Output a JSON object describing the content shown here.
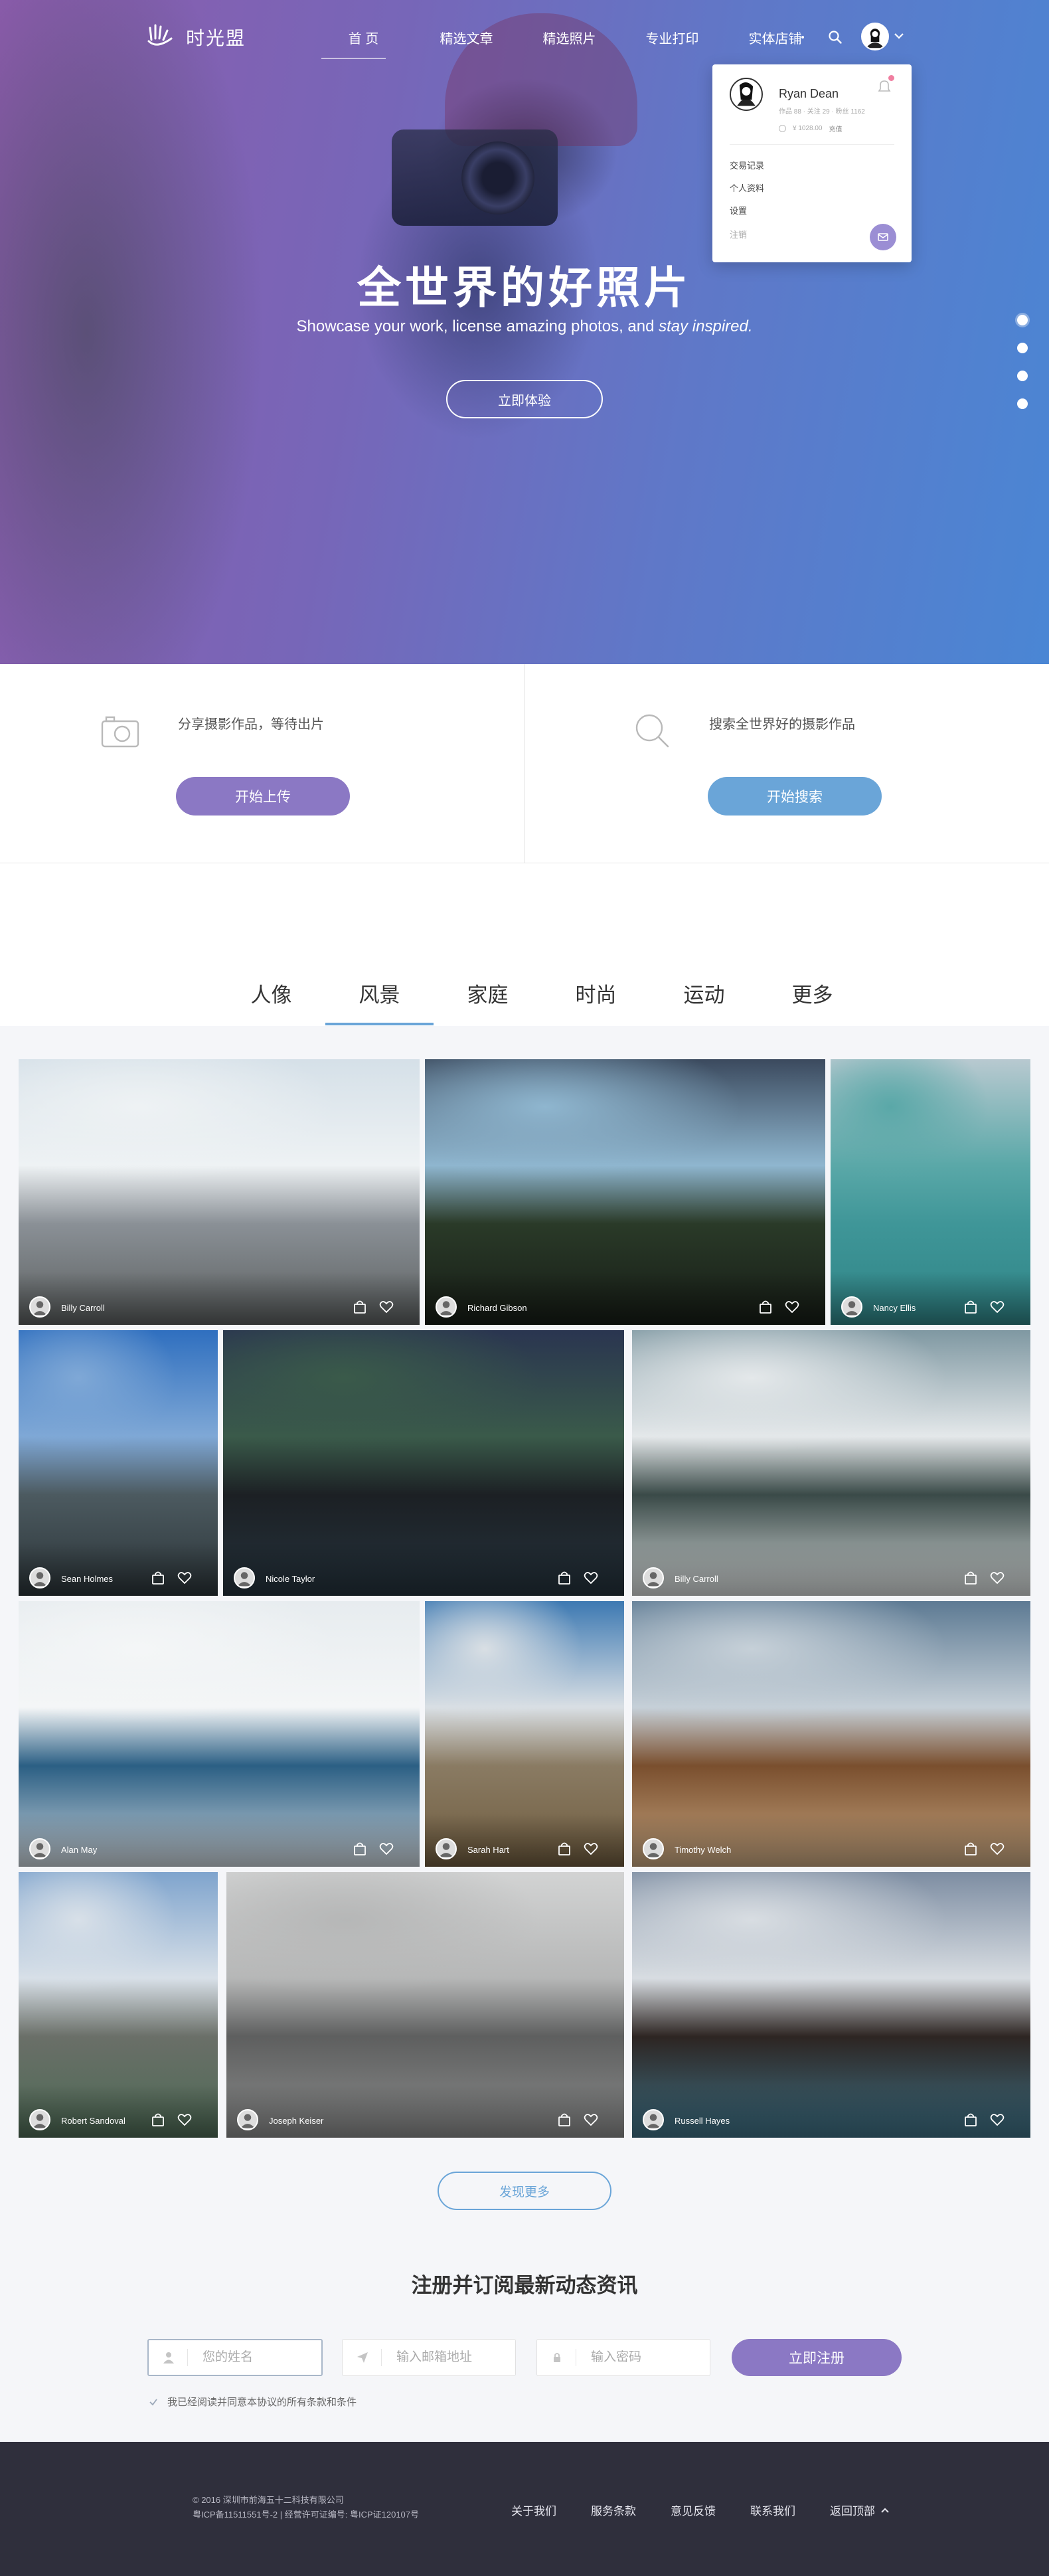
{
  "brand": {
    "name": "时光盟"
  },
  "nav": {
    "links": [
      "首 页",
      "精选文章",
      "精选照片",
      "专业打印",
      "实体店铺"
    ]
  },
  "user_menu": {
    "name": "Ryan Dean",
    "meta": "作品 88 · 关注 29 · 粉丝 1162",
    "balance": "¥ 1028.00",
    "recharge": "充值",
    "items": [
      "交易记录",
      "个人资料",
      "设置",
      "注销"
    ]
  },
  "hero": {
    "title": "全世界的好照片",
    "subtitle_main": "Showcase your work, license amazing photos, and ",
    "subtitle_em": "stay inspired.",
    "button": "立即体验",
    "slides": 4
  },
  "actions": {
    "upload_text": "分享摄影作品，等待出片",
    "upload_button": "开始上传",
    "search_text": "搜索全世界好的摄影作品",
    "search_button": "开始搜索"
  },
  "tabs": [
    "人像",
    "风景",
    "家庭",
    "时尚",
    "运动",
    "更多"
  ],
  "active_tab": "风景",
  "photos": [
    {
      "author": "Billy Carroll",
      "colors": [
        "#d5e0e8",
        "#eef2f4",
        "#8a9096",
        "#5b5f5f"
      ]
    },
    {
      "author": "Richard Gibson",
      "colors": [
        "#3b4a5e",
        "#8fb6cf",
        "#2a3a28",
        "#161c16"
      ]
    },
    {
      "author": "Nancy Ellis",
      "colors": [
        "#b8c9d0",
        "#5aa8a8",
        "#3f9698",
        "#2f8486"
      ]
    },
    {
      "author": "Sean Holmes",
      "colors": [
        "#2f6fbf",
        "#7fa8d6",
        "#4c5a60",
        "#2b3438"
      ]
    },
    {
      "author": "Nicole Taylor",
      "colors": [
        "#2a3550",
        "#3a5a4a",
        "#1c2024",
        "#24323c"
      ]
    },
    {
      "author": "Billy Carroll",
      "colors": [
        "#7f98a2",
        "#e4e8ea",
        "#3a4a48",
        "#d8dcdc"
      ]
    },
    {
      "author": "Alan May",
      "colors": [
        "#e7ecef",
        "#f4f6f7",
        "#2b5f84",
        "#ccd5dc"
      ]
    },
    {
      "author": "Sarah Hart",
      "colors": [
        "#3d79b2",
        "#d9dfe4",
        "#8a7b63",
        "#6f5c3f"
      ]
    },
    {
      "author": "Timothy Welch",
      "colors": [
        "#5d7a93",
        "#c6d0d8",
        "#7a4f2e",
        "#c7a680"
      ]
    },
    {
      "author": "Robert Sandoval",
      "colors": [
        "#7fa4cd",
        "#d8e0e8",
        "#6a6f68",
        "#4d6a55"
      ]
    },
    {
      "author": "Joseph Keiser",
      "colors": [
        "#d2d3d3",
        "#b6b7b7",
        "#5e5f5f",
        "#8b8c8c"
      ]
    },
    {
      "author": "Russell Hayes",
      "colors": [
        "#7d8da2",
        "#d8dde2",
        "#2d2522",
        "#3e7186"
      ]
    }
  ],
  "more_button": "发现更多",
  "subscribe": {
    "title": "注册并订阅最新动态资讯",
    "name_placeholder": "您的姓名",
    "email_placeholder": "输入邮箱地址",
    "password_placeholder": "输入密码",
    "submit": "立即注册",
    "agree": "我已经阅读并同意本协议的所有条款和条件"
  },
  "footer": {
    "copyright": "© 2016 深圳市前海五十二科技有限公司",
    "icp": "粤ICP备11511551号-2 | 经营许可证编号: 粤ICP证120107号",
    "links": [
      "关于我们",
      "服务条款",
      "意见反馈",
      "联系我们"
    ],
    "back_top": "返回顶部"
  },
  "colors": {
    "purple": "#8b78c4",
    "blue": "#6aa5d8",
    "footer": "#2f2f3c"
  }
}
